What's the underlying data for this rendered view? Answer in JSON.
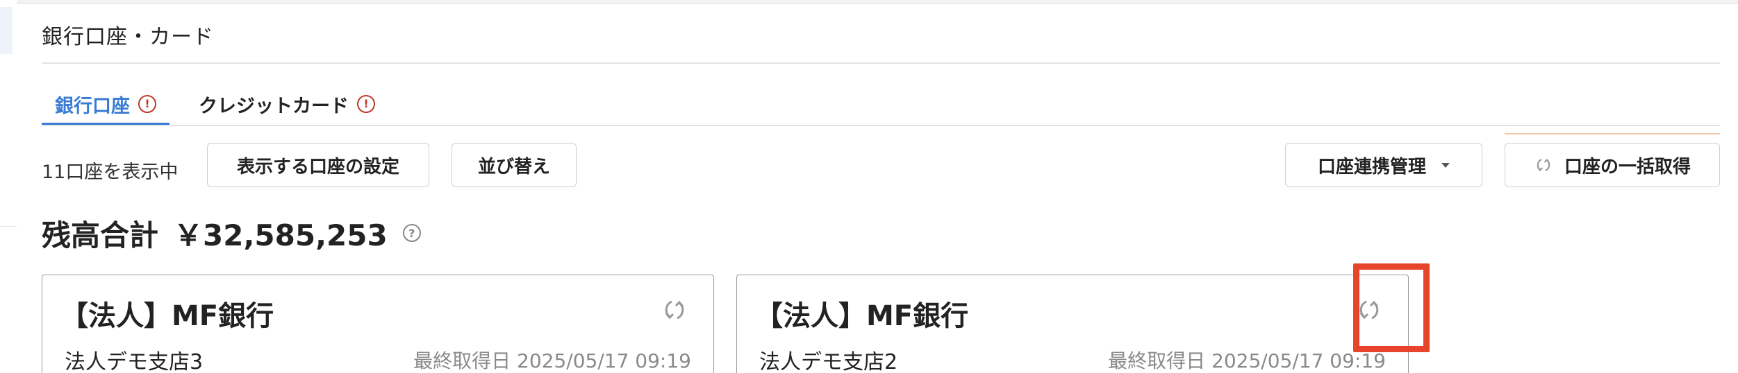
{
  "page": {
    "title": "銀行口座・カード"
  },
  "tabs": [
    {
      "label": "銀行口座",
      "active": true,
      "warning_icon": "alert-circle-icon"
    },
    {
      "label": "クレジットカード",
      "active": false,
      "warning_icon": "alert-circle-icon"
    }
  ],
  "toolbar": {
    "count_text": "11口座を表示中",
    "settings_label": "表示する口座の設定",
    "sort_label": "並び替え",
    "link_manage_label": "口座連携管理",
    "fetch_all_label": "口座の一括取得"
  },
  "summary": {
    "label": "残高合計",
    "value": "￥32,585,253",
    "help_icon": "help-circle-icon"
  },
  "accounts": [
    {
      "name": "【法人】MF銀行",
      "branch": "法人デモ支店3",
      "updated": "最終取得日 2025/05/17 09:19",
      "refresh_icon": "refresh-icon"
    },
    {
      "name": "【法人】MF銀行",
      "branch": "法人デモ支店2",
      "updated": "最終取得日 2025/05/17 09:19",
      "refresh_icon": "refresh-icon"
    }
  ],
  "colors": {
    "accent": "#3a7bd5",
    "warning": "#c0392b",
    "highlight": "#e8432b"
  }
}
